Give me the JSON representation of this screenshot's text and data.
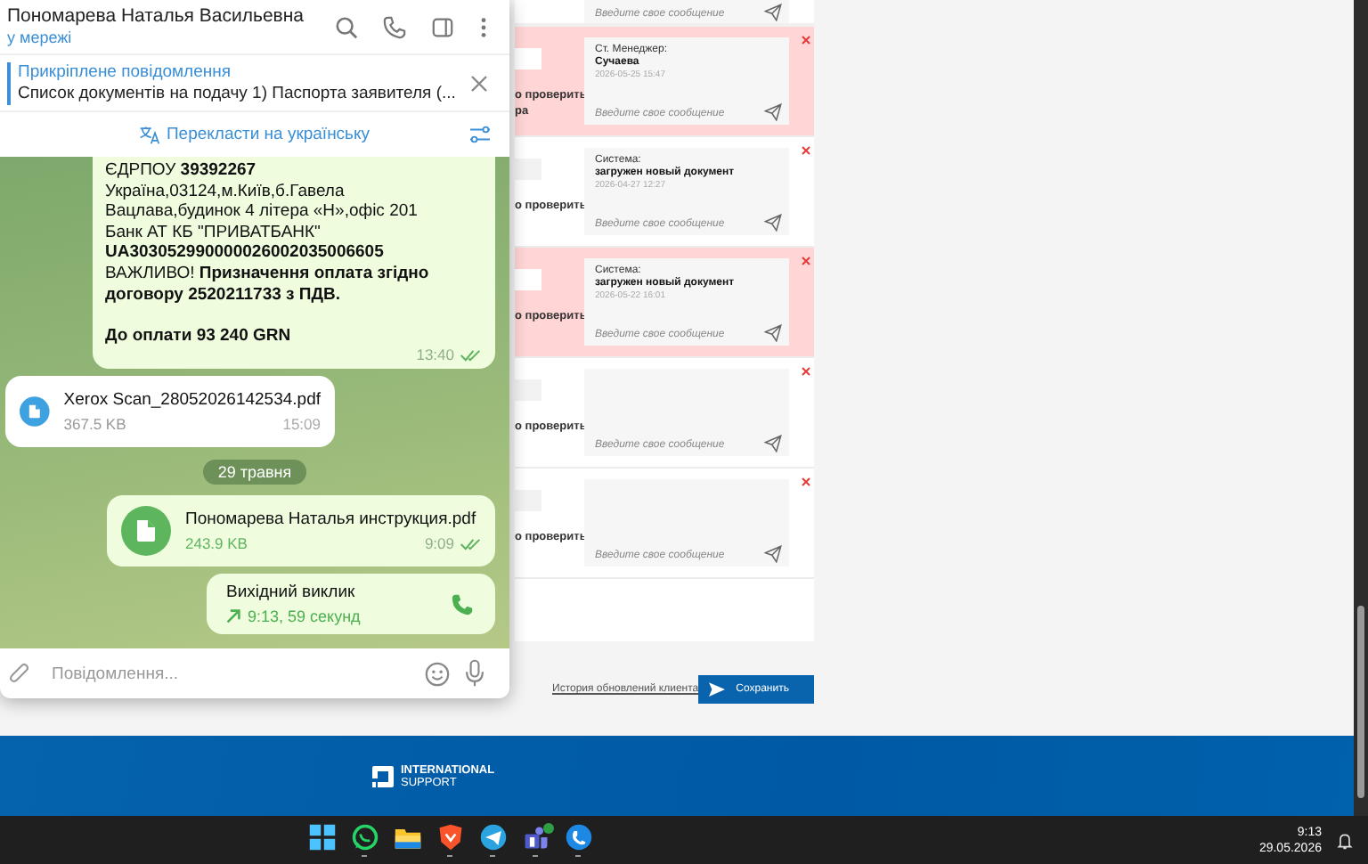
{
  "chat": {
    "contact_name": "Пономарева Наталья Васильевна",
    "status": "у мережі",
    "pinned": {
      "label": "Прикріплене повідомлення",
      "text": "Список документів на подачу  1) Паспорта заявителя (..."
    },
    "translate": "Перекласти на українську",
    "messages": [
      {
        "kind": "text",
        "outgoing": true,
        "text": "ЄДРПОУ **39392267**\nУкраїна,03124,м.Київ,б.Гавела Вацлава,будинок 4 літера «Н»,офіс 201\nБанк АТ КБ \"ПРИВАТБАНК\"\n**UA303052990000026002035006605**\nВАЖЛИВО! **Призначення оплата згідно договору 2520211733 з ПДВ.**\n\n**До оплати 93 240 GRN**",
        "time": "13:40",
        "read": true
      },
      {
        "kind": "file",
        "outgoing": false,
        "file_name": "Xerox Scan_28052026142534.pdf",
        "size": "367.5 KB",
        "time": "15:09"
      },
      {
        "kind": "date",
        "text": "29 травня"
      },
      {
        "kind": "file",
        "outgoing": true,
        "file_name": "Пономарева Наталья инструкция.pdf",
        "size": "243.9 KB",
        "time": "9:09",
        "read": true
      },
      {
        "kind": "call",
        "outgoing": true,
        "title": "Вихідний виклик",
        "detail": "9:13, 59 секунд"
      }
    ],
    "input": {
      "placeholder": "Повідомлення..."
    }
  },
  "comments": [
    {
      "kind": "tail",
      "highlighted": false,
      "placeholder": "Введите свое сообщение"
    },
    {
      "kind": "comment",
      "highlighted": true,
      "left_lines": [
        "о проверить",
        "ра"
      ],
      "author": "Ст. Менеджер:",
      "message": "Сучаева",
      "date": "2026-05-25 15:47",
      "placeholder": "Введите свое сообщение"
    },
    {
      "kind": "comment",
      "highlighted": false,
      "left_lines": [
        "о проверить"
      ],
      "author": "Система:",
      "message": "загружен новый документ",
      "date": "2026-04-27 12:27",
      "placeholder": "Введите свое сообщение"
    },
    {
      "kind": "comment",
      "highlighted": true,
      "left_lines": [
        "о проверить"
      ],
      "author": "Система:",
      "message": "загружен новый документ",
      "date": "2026-05-22 16:01",
      "placeholder": "Введите свое сообщение"
    },
    {
      "kind": "comment",
      "highlighted": false,
      "left_lines": [
        "о проверить"
      ],
      "placeholder": "Введите свое сообщение"
    },
    {
      "kind": "comment",
      "highlighted": false,
      "left_lines": [
        "о проверить"
      ],
      "placeholder": "Введите свое сообщение"
    }
  ],
  "history_link": "История обновлений клиента",
  "save_button": "Сохранить",
  "footer": {
    "logo_line1": "INTERNATIONAL",
    "logo_line2": "SUPPORT"
  },
  "taskbar": {
    "time": "9:13",
    "date": "29.05.2026",
    "apps": [
      {
        "kind": "start",
        "running": false,
        "notification": false
      },
      {
        "kind": "whatsapp",
        "running": true,
        "notification": false
      },
      {
        "kind": "folder",
        "running": false,
        "notification": false
      },
      {
        "kind": "shield",
        "running": true,
        "notification": false
      },
      {
        "kind": "plane",
        "running": true,
        "notification": false
      },
      {
        "kind": "people",
        "running": true,
        "notification": true
      },
      {
        "kind": "phone",
        "running": true,
        "notification": false
      }
    ]
  }
}
